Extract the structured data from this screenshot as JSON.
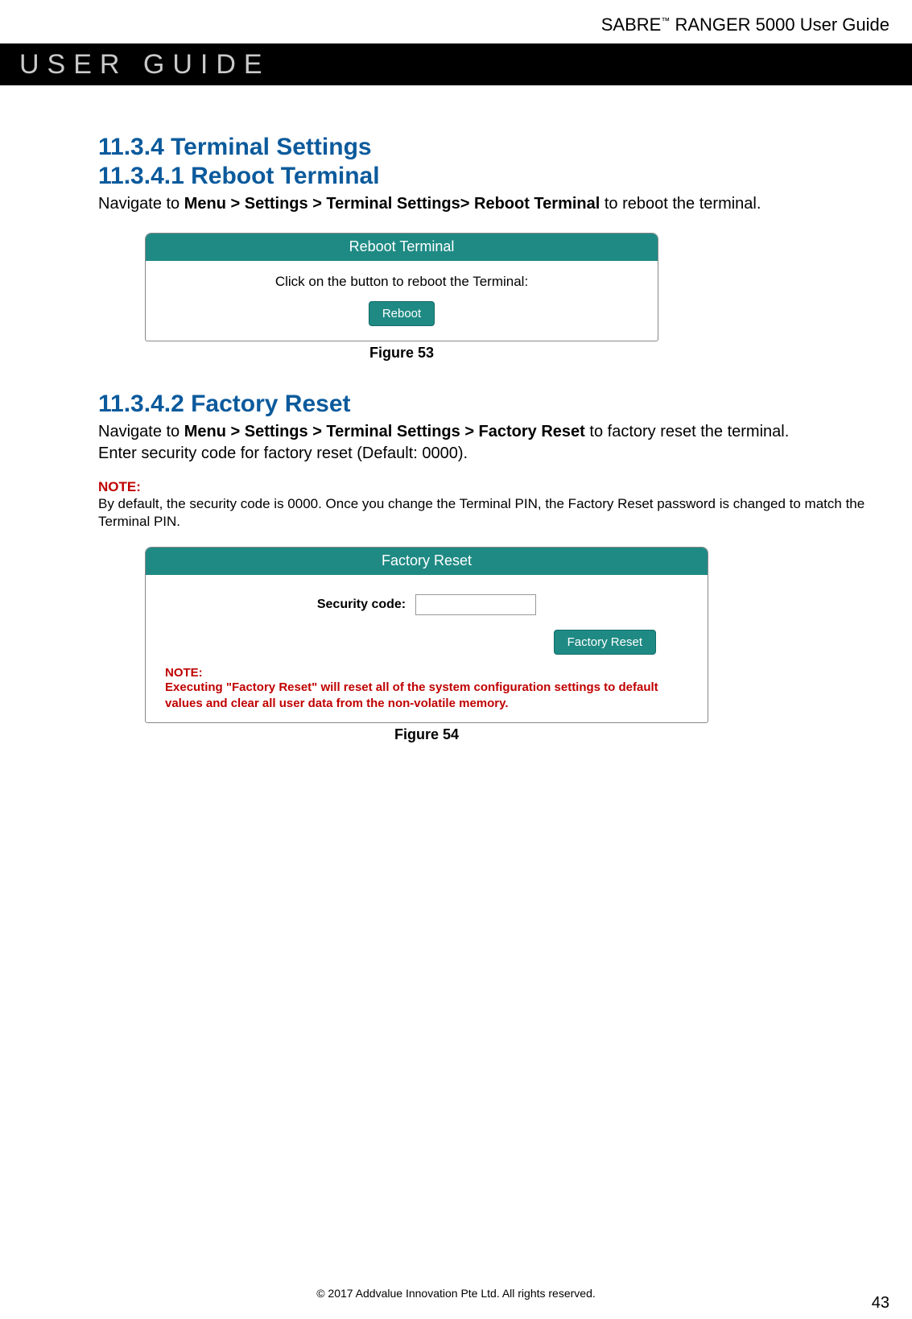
{
  "doc_header": {
    "product_prefix": "SABRE",
    "tm": "™",
    "product_suffix": " RANGER 5000 User Guide"
  },
  "banner": {
    "title": "USER GUIDE"
  },
  "section1": {
    "heading": "11.3.4 Terminal Settings",
    "sub_heading": "11.3.4.1 Reboot Terminal",
    "nav_prefix": "Navigate to ",
    "nav_bold": "Menu > Settings > Terminal Settings> Reboot Terminal",
    "nav_suffix": " to reboot the terminal."
  },
  "panel_reboot": {
    "title": "Reboot Terminal",
    "message": "Click on the button to reboot the Terminal:",
    "button": "Reboot",
    "caption": "Figure 53"
  },
  "section2": {
    "sub_heading": "11.3.4.2 Factory Reset",
    "nav_prefix": "Navigate to ",
    "nav_bold": "Menu > Settings > Terminal Settings > Factory Reset",
    "nav_suffix": " to factory reset the terminal.",
    "line2": "Enter security code for factory reset (Default: 0000)."
  },
  "note_outer": {
    "label": "NOTE:",
    "text": "By default, the security code is 0000. Once you change the Terminal PIN, the Factory Reset password is changed to match the Terminal PIN."
  },
  "panel_factory": {
    "title": "Factory Reset",
    "sec_label": "Security code:",
    "button": "Factory Reset",
    "note_title": "NOTE:",
    "note_body": "Executing \"Factory Reset\" will reset all of the system configuration settings to default values and clear all user data from the non-volatile memory.",
    "caption": "Figure 54"
  },
  "footer": {
    "copyright": "© 2017 Addvalue Innovation Pte Ltd. All rights reserved.",
    "page_number": "43"
  }
}
